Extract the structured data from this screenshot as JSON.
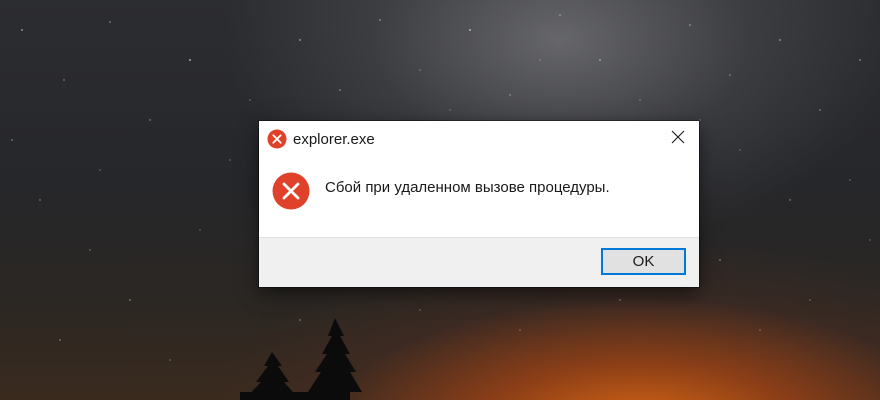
{
  "dialog": {
    "title": "explorer.exe",
    "message": "Сбой при удаленном вызове процедуры.",
    "ok_label": "OK",
    "title_icon": "error-icon",
    "message_icon": "error-icon",
    "close_icon": "close-icon"
  },
  "colors": {
    "error_red": "#e0412b",
    "button_focus_border": "#0078d7",
    "footer_bg": "#f0f0f0"
  }
}
